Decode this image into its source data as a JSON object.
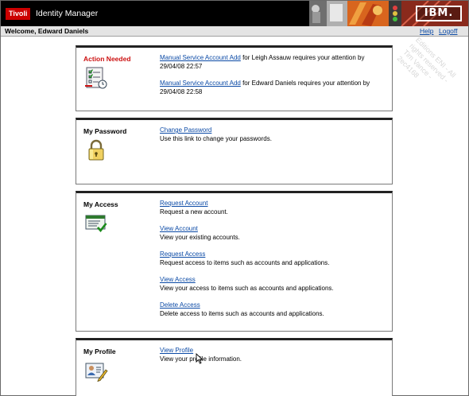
{
  "banner": {
    "brand": "Tivoli",
    "product": "Identity Manager",
    "vendor_logo": "IBM."
  },
  "header": {
    "welcome": "Welcome, Edward Daniels",
    "help_label": "Help",
    "logoff_label": "Logoff"
  },
  "portlets": {
    "action_needed": {
      "title": "Action Needed",
      "icon": "checklist-clock-icon",
      "items": [
        {
          "link": "Manual Service Account Add",
          "text": "for Leigh Assauw requires your attention by 29/04/08 22:57"
        },
        {
          "link": "Manual Service Account Add",
          "text": "for Edward Daniels requires your attention by 29/04/08 22:58"
        }
      ]
    },
    "my_password": {
      "title": "My Password",
      "icon": "padlock-icon",
      "items": [
        {
          "link": "Change Password",
          "text": "Use this link to change your passwords."
        }
      ]
    },
    "my_access": {
      "title": "My Access",
      "icon": "id-card-check-icon",
      "items": [
        {
          "link": "Request Account",
          "text": "Request a new account."
        },
        {
          "link": "View Account",
          "text": "View your existing accounts."
        },
        {
          "link": "Request Access",
          "text": "Request access to items such as accounts and applications."
        },
        {
          "link": "View Access",
          "text": "View your access to items such as accounts and applications."
        },
        {
          "link": "Delete Access",
          "text": "Delete access to items such as accounts and applications."
        }
      ]
    },
    "my_profile": {
      "title": "My Profile",
      "icon": "profile-card-pencil-icon",
      "items": [
        {
          "link": "View Profile",
          "text": "View your profile information."
        }
      ]
    }
  },
  "watermark": "Editions ENI - All rights reserved - Tim Vance - 2ec4168",
  "colors": {
    "brand_red": "#cc0000",
    "alert_red": "#cc1111",
    "link_blue": "#0b4aa6",
    "banner_black": "#000000"
  }
}
